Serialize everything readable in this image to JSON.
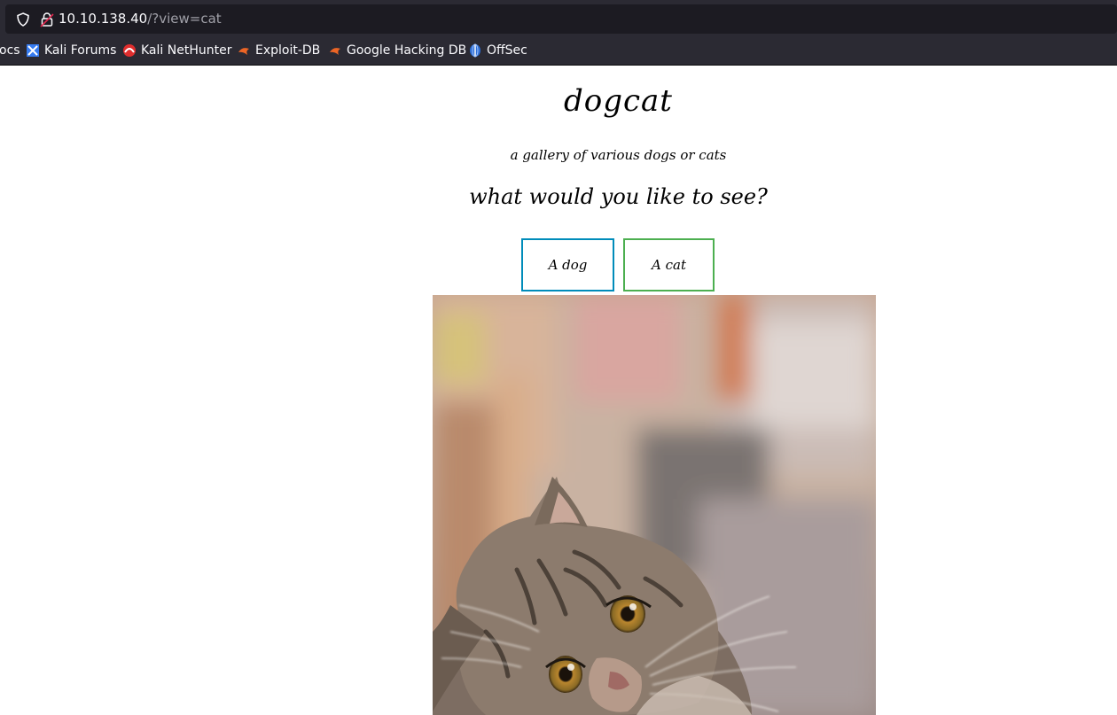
{
  "browser": {
    "url_host": "10.10.138.40",
    "url_path": "/?view=cat",
    "bookmarks": [
      {
        "label": "ocs",
        "icon": "docs-icon"
      },
      {
        "label": "Kali Forums",
        "icon": "kali-forums-icon"
      },
      {
        "label": "Kali NetHunter",
        "icon": "kali-nethunter-icon"
      },
      {
        "label": "Exploit-DB",
        "icon": "exploit-db-icon"
      },
      {
        "label": "Google Hacking DB",
        "icon": "ghdb-icon"
      },
      {
        "label": "OffSec",
        "icon": "offsec-icon"
      }
    ]
  },
  "page": {
    "title": "dogcat",
    "subtitle": "a gallery of various dogs or cats",
    "question": "what would you like to see?",
    "buttons": {
      "dog": "A dog",
      "cat": "A cat"
    },
    "image_subject": "cat photo"
  },
  "colors": {
    "dog_button_border": "#008cba",
    "cat_button_border": "#4caf50",
    "chrome_bg": "#2b2a33"
  }
}
